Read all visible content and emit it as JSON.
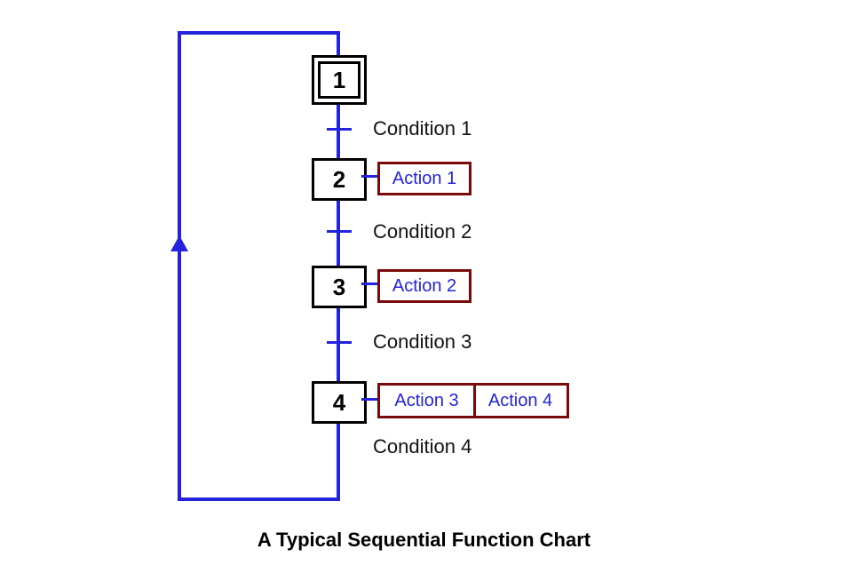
{
  "caption": "A Typical Sequential Function Chart",
  "steps": [
    {
      "label": "1",
      "initial": true,
      "actions": []
    },
    {
      "label": "2",
      "initial": false,
      "actions": [
        "Action 1"
      ]
    },
    {
      "label": "3",
      "initial": false,
      "actions": [
        "Action 2"
      ]
    },
    {
      "label": "4",
      "initial": false,
      "actions": [
        "Action 3",
        "Action 4"
      ]
    }
  ],
  "transitions": [
    {
      "label": "Condition 1"
    },
    {
      "label": "Condition 2"
    },
    {
      "label": "Condition 3"
    },
    {
      "label": "Condition 4"
    }
  ],
  "colors": {
    "connector": "#2323dd",
    "step_border": "#000000",
    "action_border": "#7a0a0a",
    "action_text": "#2323dd",
    "condition_text": "#111111"
  },
  "flow": {
    "sequence": [
      "step1",
      "t1",
      "step2",
      "t2",
      "step3",
      "t3",
      "step4",
      "t4",
      "loop_to_step1"
    ],
    "feedback_arrow_direction": "up"
  }
}
